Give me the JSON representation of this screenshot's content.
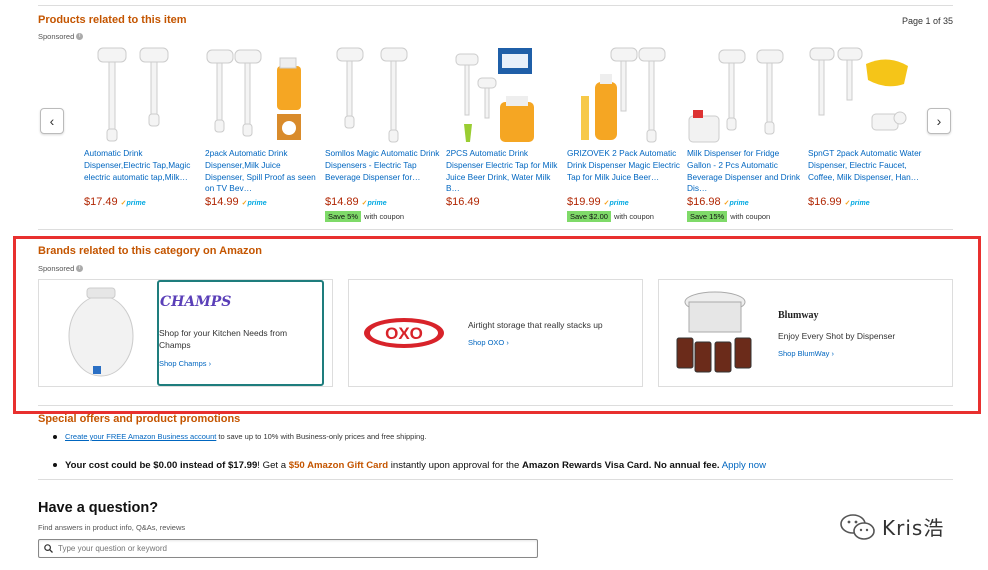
{
  "related": {
    "title": "Products related to this item",
    "sponsored": "Sponsored",
    "page_indicator": "Page 1 of 35",
    "prime_label": "prime",
    "items": [
      {
        "title": "Automatic Drink Dispenser,Electric Tap,Magic electric automatic tap,Milk…",
        "price": "$17.49",
        "prime": true
      },
      {
        "title": "2pack Automatic Drink Dispenser,Milk Juice Dispenser, Spill Proof as seen on TV Bev…",
        "price": "$14.99",
        "prime": true
      },
      {
        "title": "Somllos Magic Automatic Drink Dispensers - Electric Tap Beverage Dispenser for…",
        "price": "$14.89",
        "prime": true,
        "coupon": "Save 5%",
        "coupon_text": "with coupon"
      },
      {
        "title": "2PCS Automatic Drink Dispenser Electric Tap for Milk Juice Beer Drink, Water Milk B…",
        "price": "$16.49",
        "prime": false
      },
      {
        "title": "GRIZOVEK 2 Pack Automatic Drink Dispenser Magic Electric Tap for Milk Juice Beer…",
        "price": "$19.99",
        "prime": true,
        "coupon": "Save $2.00",
        "coupon_text": "with coupon"
      },
      {
        "title": "Milk Dispenser for Fridge Gallon - 2 Pcs Automatic Beverage Dispenser and Drink Dis…",
        "price": "$16.98",
        "prime": true,
        "coupon": "Save 15%",
        "coupon_text": "with coupon"
      },
      {
        "title": "SpnGT 2pack Automatic Water Dispenser, Electric Faucet, Coffee, Milk Dispenser, Han…",
        "price": "$16.99",
        "prime": true
      }
    ]
  },
  "brands": {
    "title": "Brands related to this category on Amazon",
    "sponsored": "Sponsored",
    "cards": [
      {
        "logo": "CHAMPS",
        "text": "Shop for your Kitchen Needs from Champs",
        "link": "Shop Champs ›"
      },
      {
        "logo": "OXO",
        "text": "Airtight storage that really stacks up",
        "link": "Shop OXO ›"
      },
      {
        "logo": "Blumway",
        "text": "Enjoy Every Shot by Dispenser",
        "link": "Shop BlumWay ›"
      }
    ]
  },
  "offers": {
    "title": "Special offers and product promotions",
    "line1_link": "Create your FREE Amazon Business account",
    "line1_rest": " to save up to 10% with Business-only prices and free shipping.",
    "line2_bold": "Your cost could be $0.00 instead of $17.99",
    "line2_mid1": "! Get a ",
    "line2_gift": "$50 Amazon Gift Card",
    "line2_mid2": " instantly upon approval for the ",
    "line2_card": "Amazon Rewards Visa Card. No annual fee.",
    "line2_apply": "Apply now"
  },
  "question": {
    "title": "Have a question?",
    "subtitle": "Find answers in product info, Q&As, reviews",
    "placeholder": "Type your question or keyword"
  },
  "watermark": "Kris浩",
  "colors": {
    "accent": "#c45500",
    "link": "#0066c0",
    "price": "#b12704",
    "highlight": "#e8302f",
    "coupon": "#7fda69"
  }
}
